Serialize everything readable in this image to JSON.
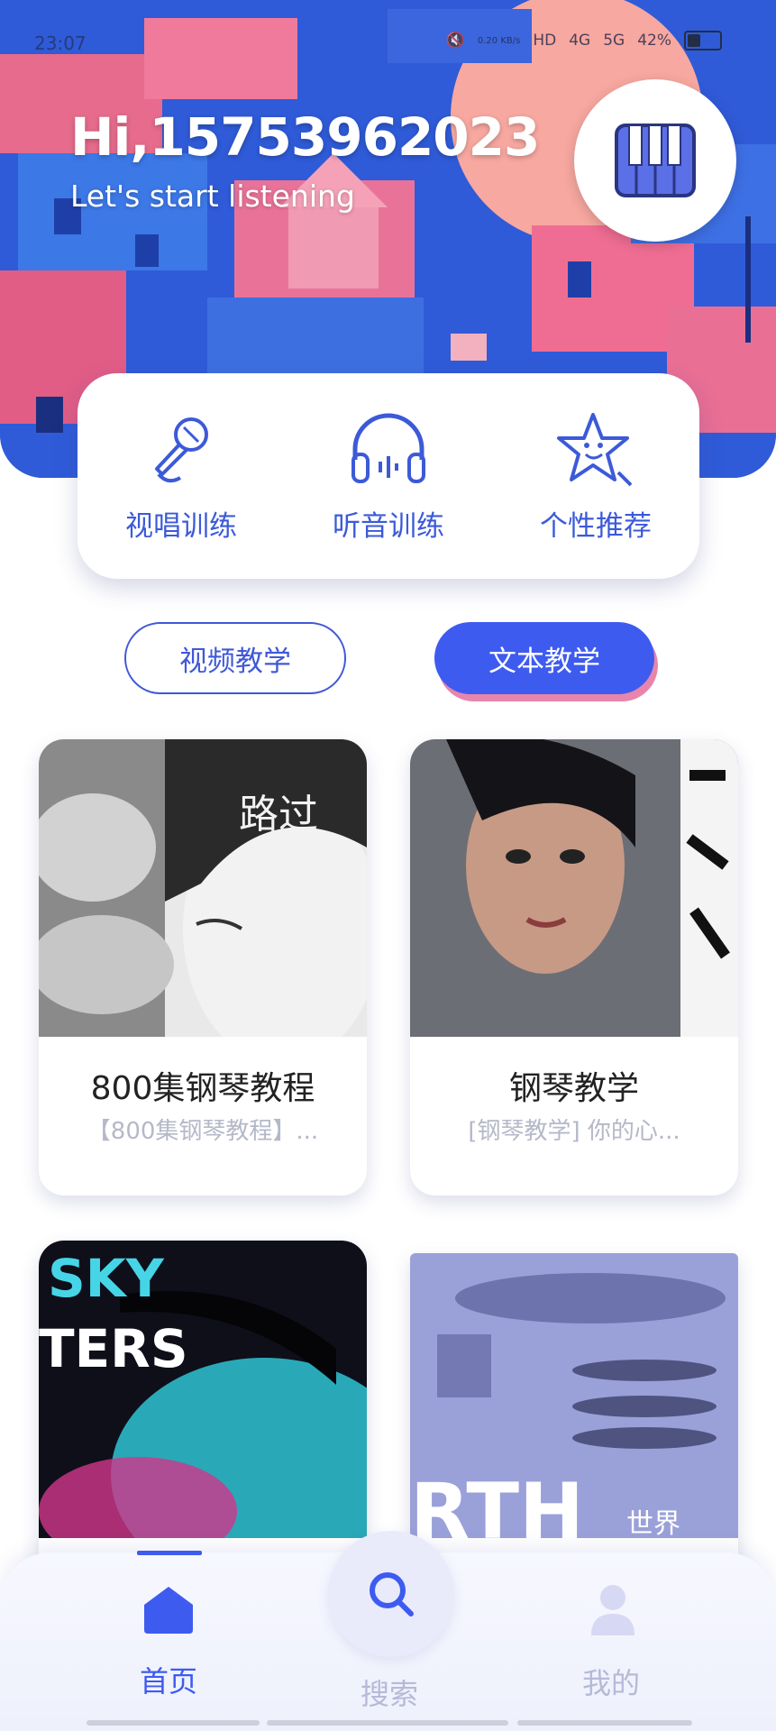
{
  "status_bar": {
    "time": "23:07",
    "network_speed": "0.20 KB/s",
    "hd": "HD",
    "net1": "4G",
    "net2": "5G",
    "battery": "42%"
  },
  "header": {
    "greeting": "Hi,15753962023",
    "subtitle": "Let's start listening",
    "piano_icon": "piano-icon"
  },
  "features": [
    {
      "label": "视唱训练",
      "icon": "microphone-icon"
    },
    {
      "label": "听音训练",
      "icon": "headphones-icon"
    },
    {
      "label": "个性推荐",
      "icon": "star-face-icon"
    }
  ],
  "tabs": {
    "video": "视频教学",
    "text": "文本教学",
    "active": "text"
  },
  "cards": [
    {
      "title": "800集钢琴教程",
      "desc": "【800集钢琴教程】..."
    },
    {
      "title": "钢琴教学",
      "desc": "[钢琴教学] 你的心..."
    },
    {
      "title": "",
      "desc": ""
    },
    {
      "title": "",
      "desc": ""
    }
  ],
  "card_image_text": {
    "card1": "路过",
    "card3": "SKY\nTERS",
    "card4_a": "RTH",
    "card4_b": "世界"
  },
  "bottom_nav": {
    "home": "首页",
    "search": "搜索",
    "mine": "我的",
    "active": "home"
  },
  "colors": {
    "accent": "#3e5bf0",
    "pink": "#e785ab",
    "banner_blue": "#2f5bd8"
  }
}
